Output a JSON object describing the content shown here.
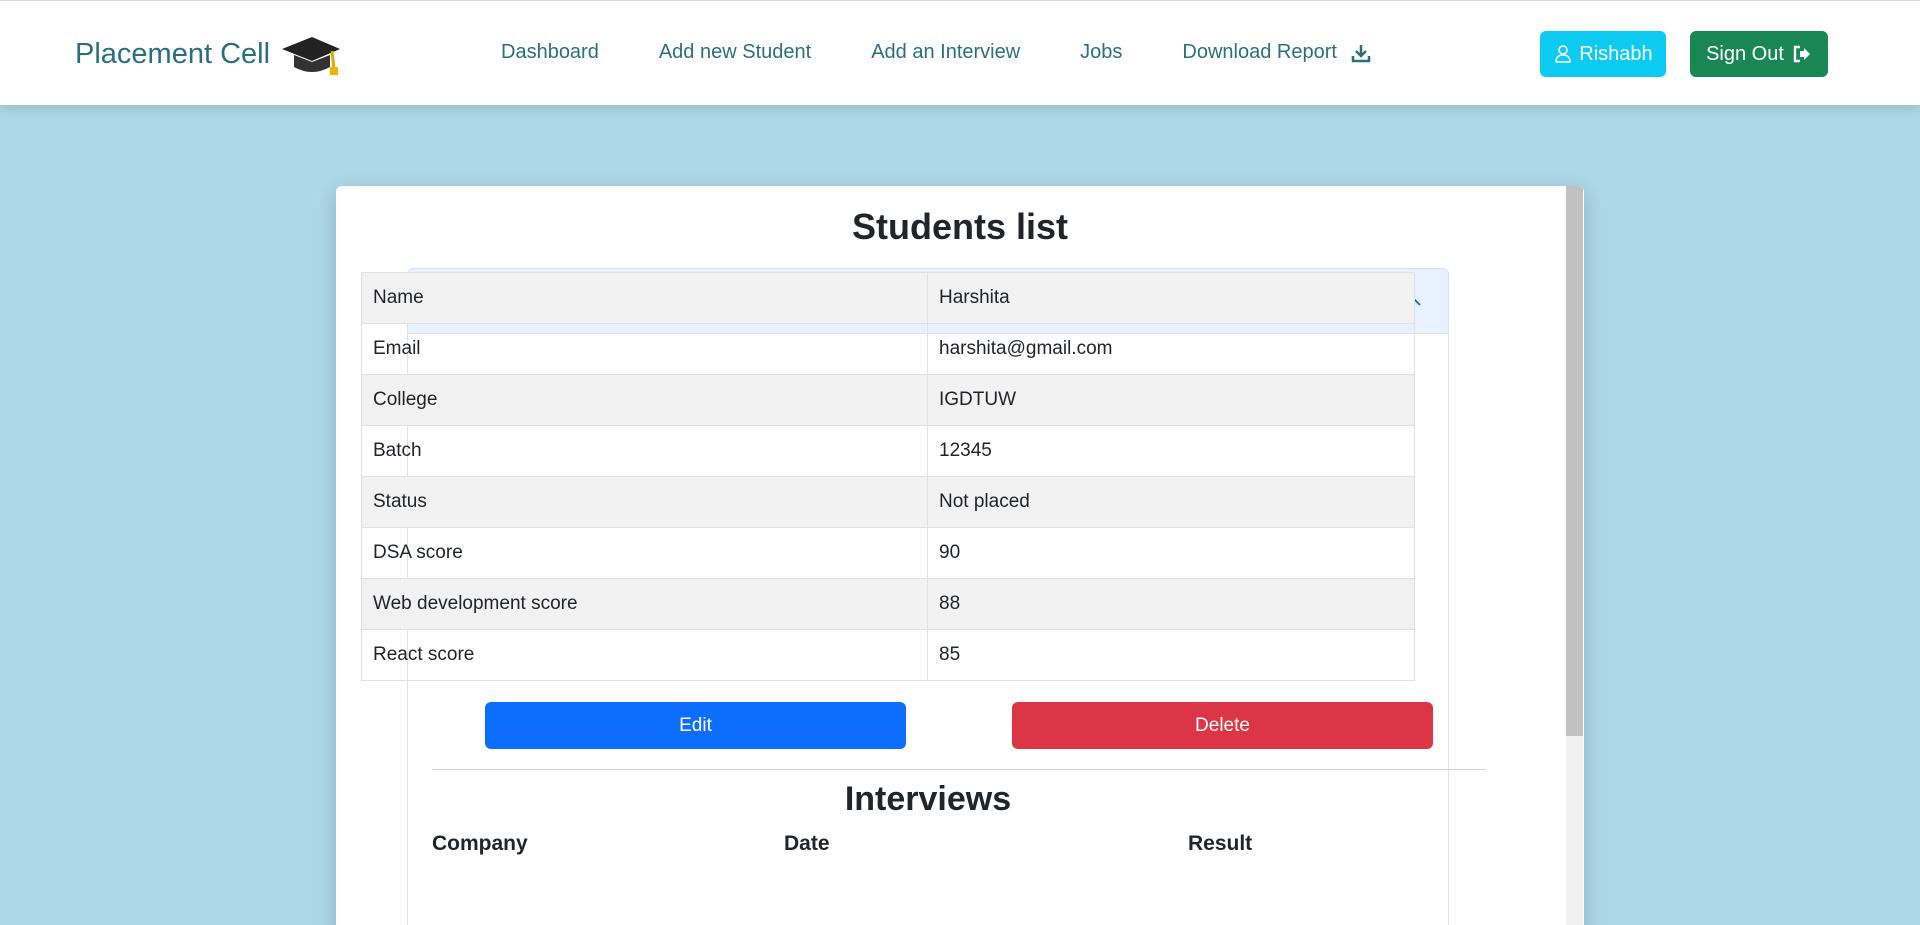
{
  "navbar": {
    "brand": "Placement Cell",
    "links": [
      "Dashboard",
      "Add new Student",
      "Add an Interview",
      "Jobs",
      "Download Report"
    ],
    "user_button": "Rishabh",
    "signout_button": "Sign Out",
    "colors": {
      "brand": "#2a6f7f",
      "user_button": "#0dcaf0",
      "signout_button": "#198754"
    }
  },
  "page": {
    "title": "Students list",
    "background": "#add8e6"
  },
  "student": {
    "accordion_header": "Harshita",
    "details": [
      {
        "label": "Name",
        "value": "Harshita"
      },
      {
        "label": "Email",
        "value": "harshita@gmail.com"
      },
      {
        "label": "College",
        "value": "IGDTUW"
      },
      {
        "label": "Batch",
        "value": "12345"
      },
      {
        "label": "Status",
        "value": "Not placed"
      },
      {
        "label": "DSA score",
        "value": "90"
      },
      {
        "label": "Web development score",
        "value": "88"
      },
      {
        "label": "React score",
        "value": "85"
      }
    ],
    "edit_button": "Edit",
    "delete_button": "Delete"
  },
  "interviews": {
    "title": "Interviews",
    "columns": [
      "Company",
      "Date",
      "Result"
    ]
  },
  "icons": {
    "brand": "graduation-cap-icon",
    "download": "download-icon",
    "user": "user-icon",
    "signout": "sign-out-icon",
    "accordion": "chevron-up-icon"
  }
}
